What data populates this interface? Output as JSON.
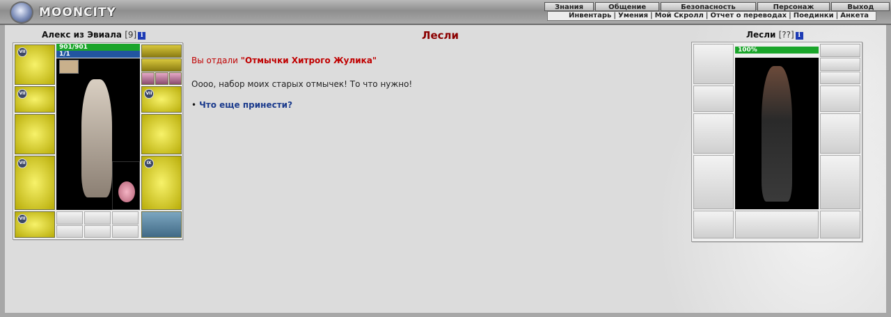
{
  "header": {
    "logo_text": "MOONCITY",
    "nav_main": [
      "Знания",
      "Общение",
      "Безопасность",
      "Персонаж",
      "Выход"
    ],
    "nav_sub": [
      "Инвентарь",
      "Умения",
      "Мой Скролл",
      "Отчет о переводах",
      "Поединки",
      "Анкета"
    ]
  },
  "player": {
    "name": "Алекс из Эвиала",
    "level": "[9]",
    "hp": "901/901",
    "mana": "1/1",
    "slot_badges": [
      "VII",
      "VII",
      "VII",
      "VII",
      "VII",
      "IX"
    ]
  },
  "npc": {
    "name": "Лесли",
    "level": "[??]",
    "hp": "100%"
  },
  "dialog": {
    "title": "Лесли",
    "gave_prefix": "Вы отдали ",
    "gave_item": "\"Отмычки Хитрого Жулика\"",
    "npc_says": "Оооо, набор моих старых отмычек! То что нужно!",
    "reply_bullet": "•",
    "reply_option": "Что еще принести?"
  }
}
